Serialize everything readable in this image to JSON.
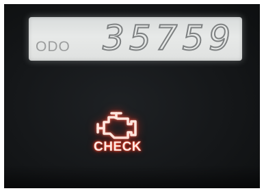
{
  "odometer": {
    "label": "ODO",
    "value": "35759"
  },
  "warning": {
    "icon": "check-engine-icon",
    "label": "CHECK",
    "color": "#ff3a20"
  },
  "lcd": {
    "background_color": "#e4e6e5"
  }
}
